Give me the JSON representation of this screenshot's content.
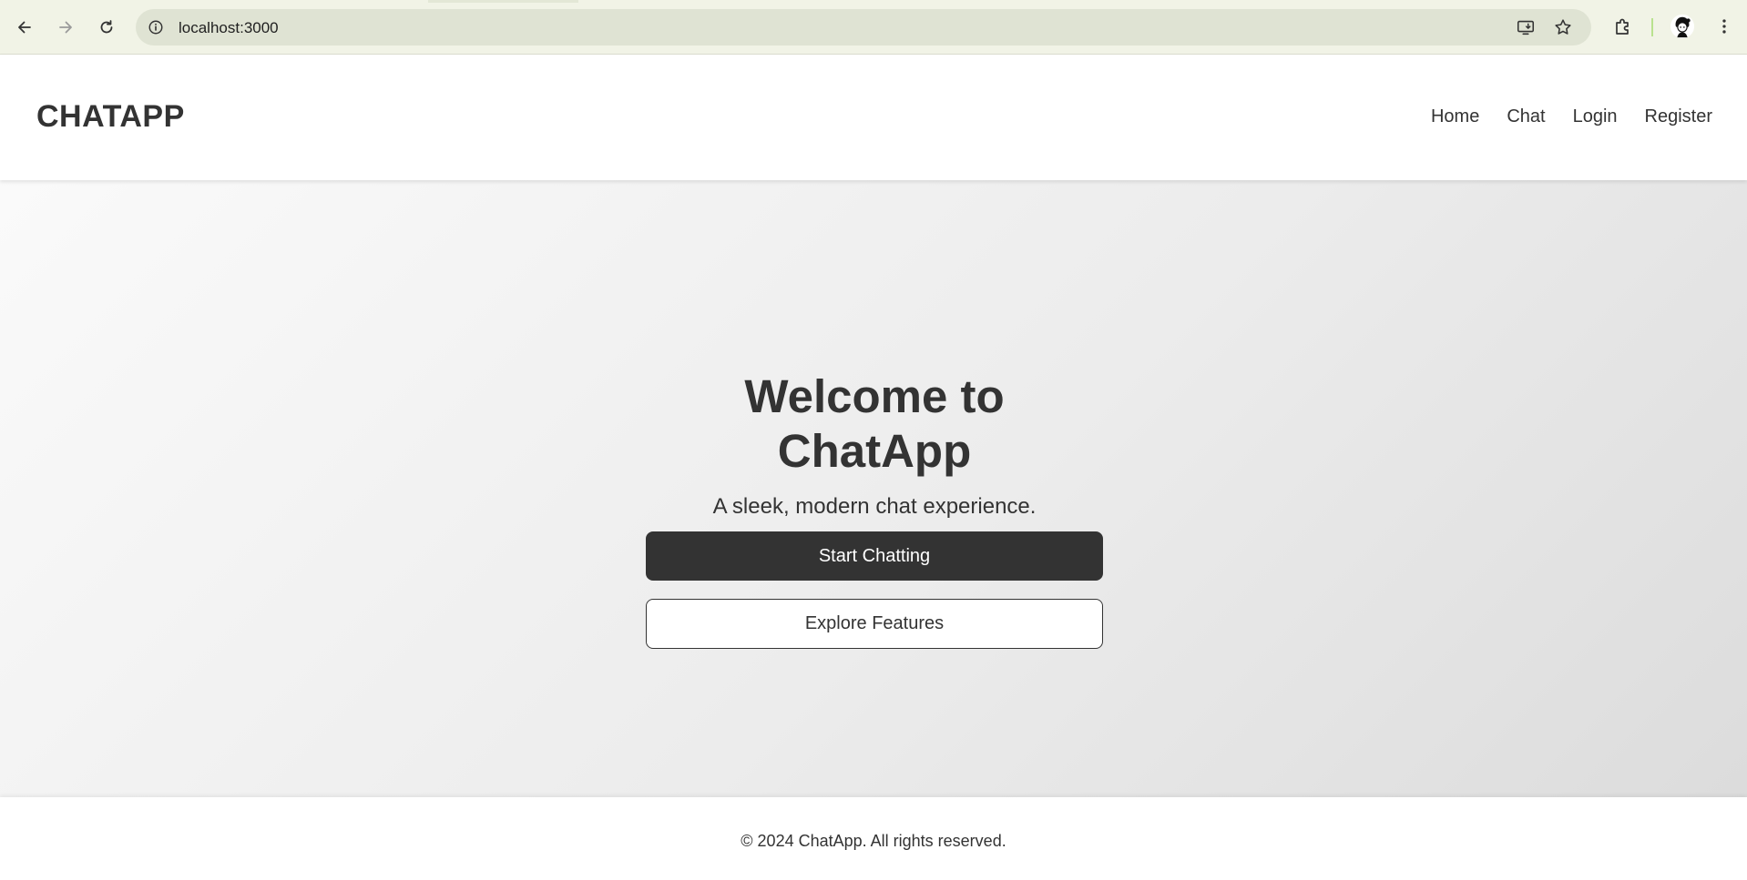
{
  "browser": {
    "url": "localhost:3000",
    "icons": {
      "back": "arrow-left-icon",
      "forward": "arrow-right-icon",
      "reload": "reload-icon",
      "site_info": "info-icon",
      "install": "install-app-icon",
      "bookmark": "star-icon",
      "extensions": "puzzle-icon",
      "profile": "avatar",
      "menu": "kebab-menu-icon"
    }
  },
  "header": {
    "logo": "CHATAPP",
    "nav": [
      {
        "label": "Home"
      },
      {
        "label": "Chat"
      },
      {
        "label": "Login"
      },
      {
        "label": "Register"
      }
    ]
  },
  "hero": {
    "title": "Welcome to ChatApp",
    "subtitle": "A sleek, modern chat experience.",
    "primary_button": "Start Chatting",
    "secondary_button": "Explore Features"
  },
  "footer": {
    "text": "© 2024 ChatApp. All rights reserved."
  },
  "colors": {
    "text": "#333333",
    "primary_button_bg": "#333333",
    "primary_button_text": "#ffffff",
    "header_bg": "#ffffff",
    "browser_bar_bg": "#f1f3e6"
  }
}
